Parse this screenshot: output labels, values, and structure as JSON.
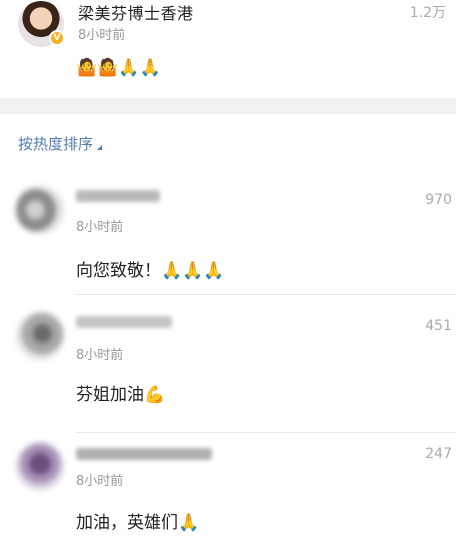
{
  "post": {
    "author": "梁美芬博士香港",
    "verified_icon": "verified-badge-icon",
    "time": "8小时前",
    "count": "1.2万",
    "emojis": "🤷🤷🙏🙏"
  },
  "sort": {
    "label": "按热度排序"
  },
  "comments": [
    {
      "time": "8小时前",
      "likes": "970",
      "text": "向您致敬！🙏🙏🙏"
    },
    {
      "time": "8小时前",
      "likes": "451",
      "text": "芬姐加油💪"
    },
    {
      "time": "8小时前",
      "likes": "247",
      "text": "加油，英雄们🙏"
    }
  ],
  "colors": {
    "link_blue": "#507daf",
    "muted": "#999999",
    "separator": "#f2f2f2"
  }
}
